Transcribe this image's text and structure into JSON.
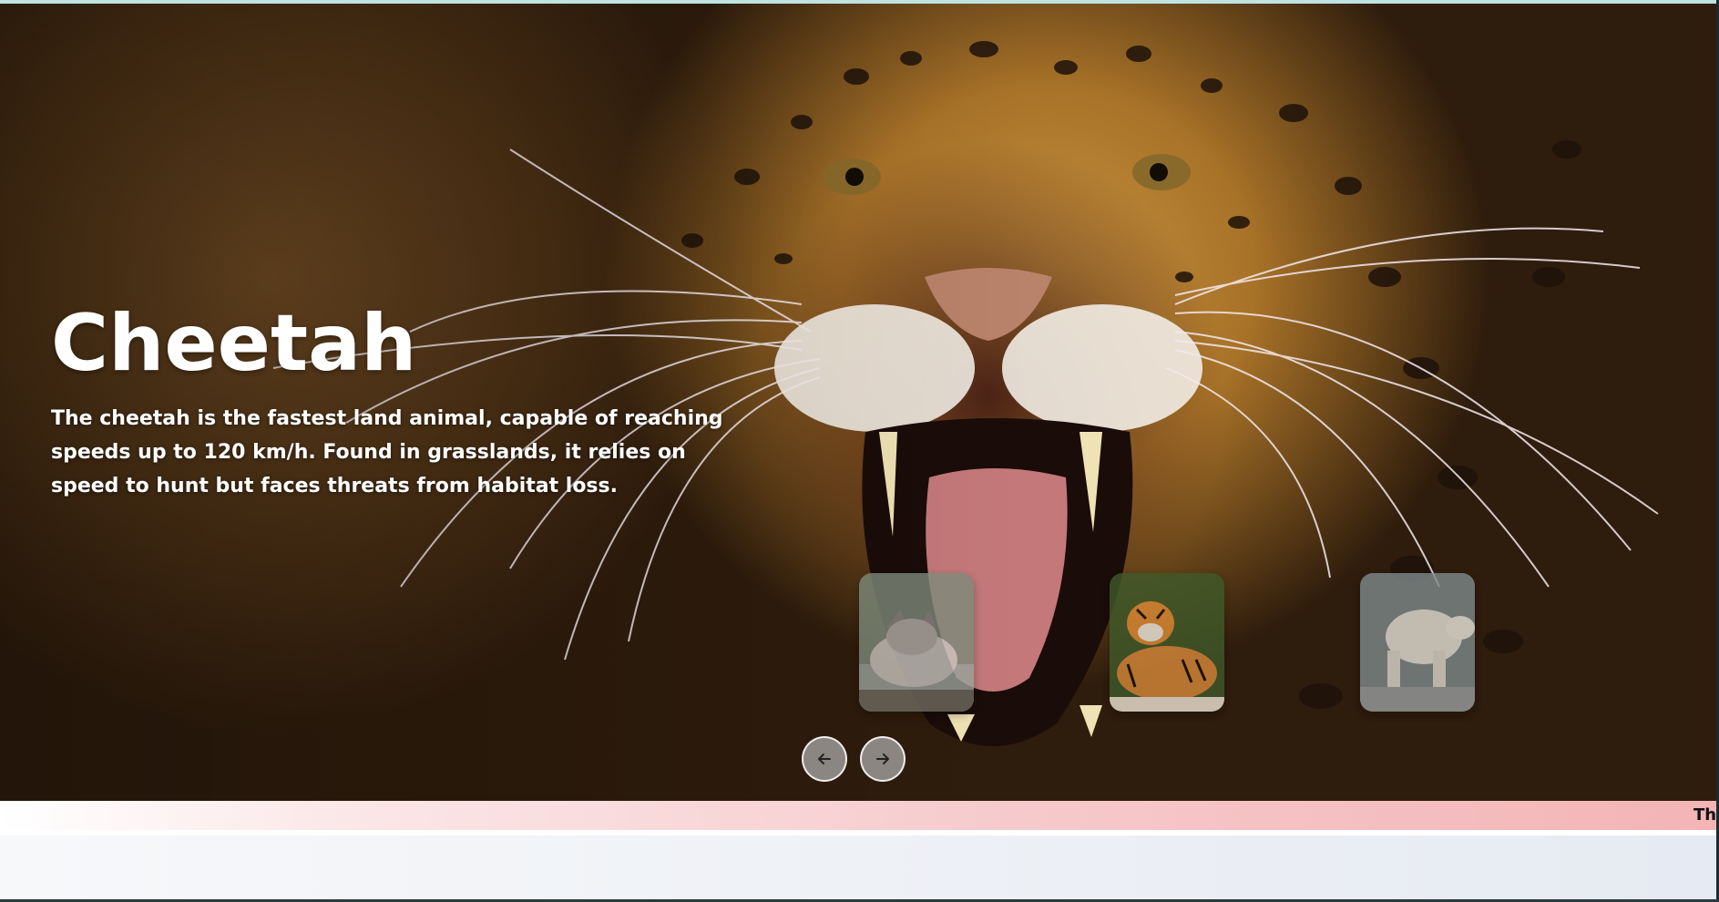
{
  "hero": {
    "title": "Cheetah",
    "description": "The cheetah is the fastest land animal, capable of reaching speeds up to 120 km/h. Found in grasslands, it relies on speed to hunt but faces threats from habitat loss."
  },
  "thumbnails": [
    {
      "animal": "wolf"
    },
    {
      "animal": "tiger"
    },
    {
      "animal": "polar-bear"
    }
  ],
  "navigation": {
    "prev_icon": "arrow-left-icon",
    "next_icon": "arrow-right-icon"
  },
  "marquee": {
    "text": "Thi"
  },
  "colors": {
    "hero_text": "#ffffff",
    "marquee_start": "#ffffff",
    "marquee_end": "#f3b4b6",
    "nav_button": "#b4b4b4"
  }
}
